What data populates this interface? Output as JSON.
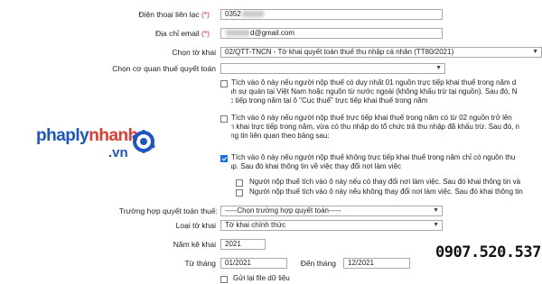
{
  "form": {
    "phone_label": "Điện thoại liên lạc",
    "phone_required": "(*)",
    "phone_value": "0352",
    "email_label": "Địa chỉ email",
    "email_required": "(*)",
    "email_value_suffix": "d@gmail.com",
    "declaration_label": "Chọn tờ khai",
    "declaration_value": "02/QTT-TNCN - Tờ khai quyết toán thuế thu nhập cá nhân (TT80/2021)",
    "tax_office_label": "Chọn cơ quan thuế quyết toán",
    "tax_office_value": "",
    "check1_lines": [
      "Tích vào ô này nếu người nộp thuế có duy nhất 01 nguồn trực tiếp khai thuế trong năm d",
      "Lãnh sự quán tại Việt Nam hoặc nguồn từ nước ngoài (không khấu trừ tại nguồn). Sau đó, N",
      "trực tiếp trong năm tại ô \"Cục thuế\" trực tiếp khai thuế trong năm"
    ],
    "check1_checked": false,
    "check2_lines": [
      "Tích vào ô này nếu người nộp thuế trực tiếp khai thuế trong năm có từ 02 nguồn trở lên",
      "diện khai trực tiếp trong năm, vừa có thu nhập do tổ chức trả thu nhập đã khấu trừ. Sau đó, n",
      "thông tin liên quan theo bảng sau:"
    ],
    "check2_checked": false,
    "check3_lines": [
      "Tích vào ô này nếu người nộp thuế không trực tiếp khai thuế trong năm chỉ có nguồn thu",
      "nhập. Sau đó khai thông tin về việc thay đổi nơi làm việc"
    ],
    "check3_checked": true,
    "sub1_text": "Người nộp thuế tích vào ô này nếu có thay đổi nơi làm việc. Sau đó khai thông tin và",
    "sub1_checked": false,
    "sub2_text": "Người nộp thuế tích vào ô này nếu không thay đổi nơi làm việc. Sau đó khai thông tin",
    "sub2_checked": false,
    "case_label": "Trường hợp quyết toán thuế:",
    "case_value": "-----Chọn trường hợp quyết toán-----",
    "type_label": "Loại tờ khai",
    "type_value": "Tờ khai chính thức",
    "year_label": "Năm kê khai",
    "year_value": "2021",
    "from_label": "Từ tháng",
    "from_value": "01/2021",
    "to_label": "Đến tháng",
    "to_value": "12/2021",
    "resend_label": "Gửi lại file dữ liệu",
    "resend_checked": false
  },
  "watermark": {
    "brand_part1": "phaply",
    "brand_part2": "nhanh",
    "brand_suffix": ".vn",
    "phone": "0907.520.537",
    "colors": {
      "part1": "#1e55c4",
      "part2": "#e53a2f",
      "suffix": "#1e55c4"
    }
  }
}
